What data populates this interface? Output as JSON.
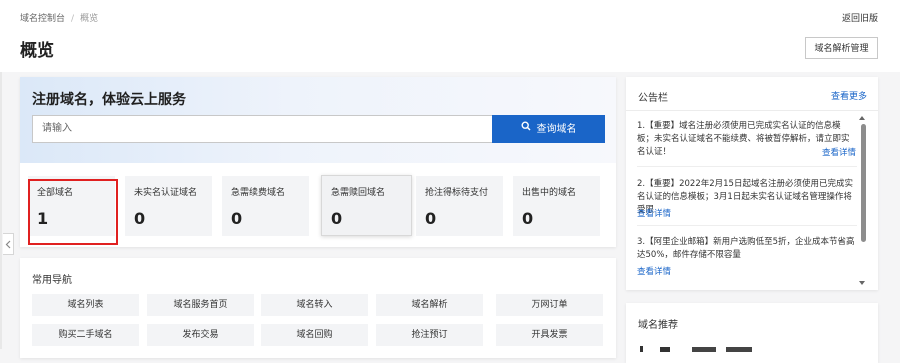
{
  "breadcrumb": {
    "root": "域名控制台",
    "separator": "/",
    "current": "概览"
  },
  "header": {
    "back_label": "返回旧版",
    "title": "概览",
    "dns_button": "域名解析管理"
  },
  "hero": {
    "title": "注册域名，体验云上服务",
    "search_placeholder": "请输入",
    "search_button": "查询域名",
    "search_icon": "search-icon"
  },
  "stats": [
    {
      "label": "全部域名",
      "value": "1"
    },
    {
      "label": "未实名认证域名",
      "value": "0"
    },
    {
      "label": "急需续费域名",
      "value": "0"
    },
    {
      "label": "急需赎回域名",
      "value": "0"
    },
    {
      "label": "抢注得标待支付",
      "value": "0"
    },
    {
      "label": "出售中的域名",
      "value": "0"
    }
  ],
  "nav": {
    "title": "常用导航",
    "rows": [
      [
        "域名列表",
        "域名服务首页",
        "域名转入",
        "域名解析",
        "万网订单"
      ],
      [
        "购买二手域名",
        "发布交易",
        "域名回购",
        "抢注预订",
        "开具发票"
      ]
    ]
  },
  "notices": {
    "title": "公告栏",
    "more": "查看更多",
    "items": [
      {
        "text": "1.【重要】域名注册必须使用已完成实名认证的信息模板；未实名认证域名不能续费、将被暂停解析，请立即实名认证！",
        "link": "查看详情"
      },
      {
        "text": "2.【重要】2022年2月15日起域名注册必须使用已完成实名认证的信息模板；3月1日起未实名认证域名管理操作将受限",
        "link": "查看详情"
      },
      {
        "text": "3.【阿里企业邮箱】新用户选购低至5折，企业成本节省高达50%，邮件存储不限容量",
        "link": "查看详情"
      }
    ]
  },
  "recommend": {
    "title": "域名推荐"
  },
  "colors": {
    "accent": "#1a65c8",
    "highlight": "#e02020"
  }
}
